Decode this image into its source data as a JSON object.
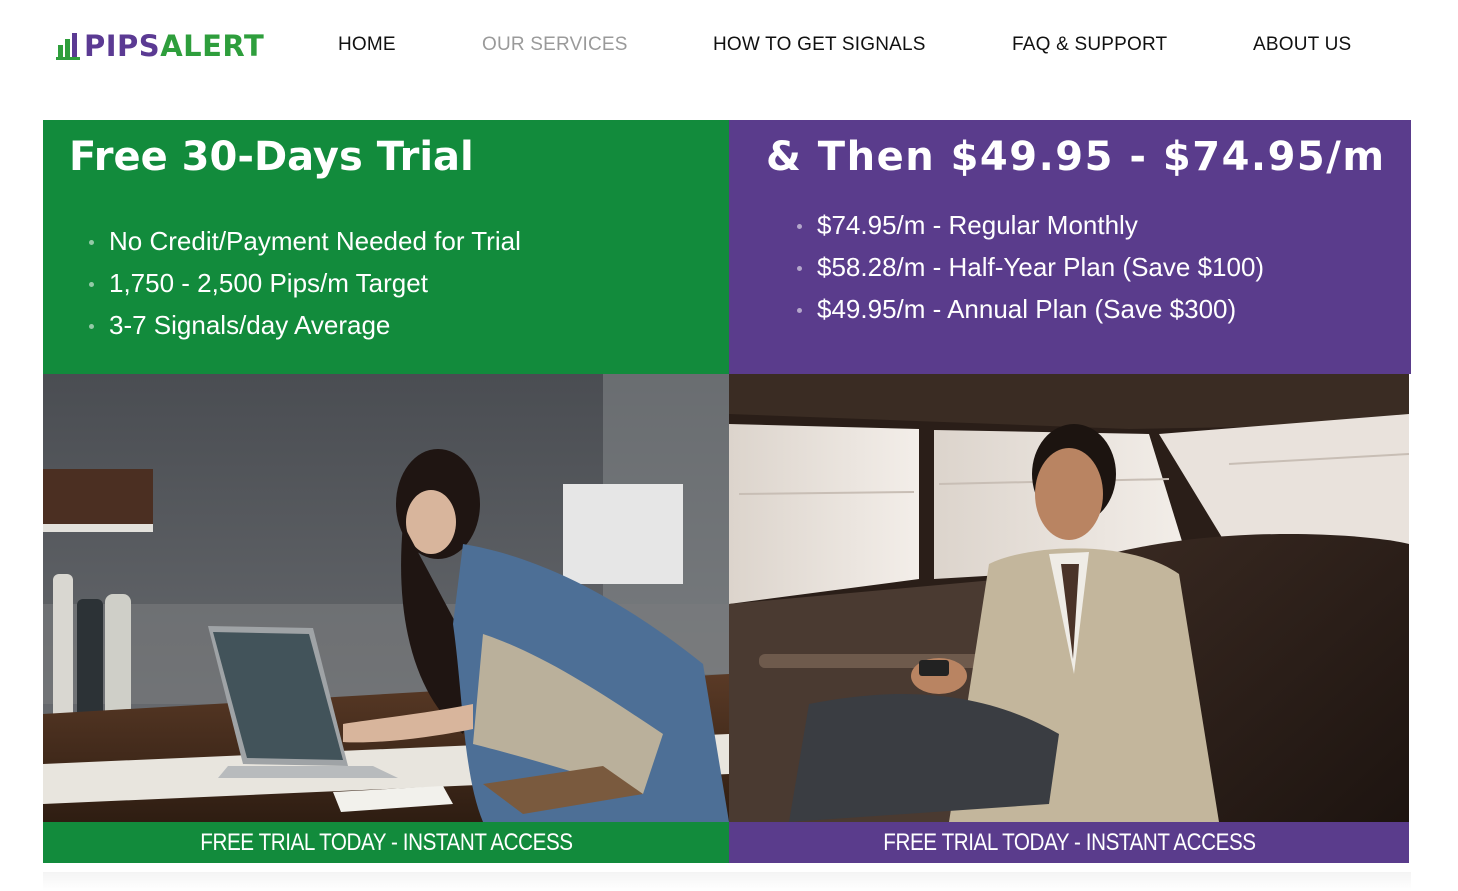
{
  "colors": {
    "brand_purple": "#5a3c8c",
    "brand_green": "#128b3c",
    "nav_active": "#9a9a9a"
  },
  "logo": {
    "text_part1": "PIPS",
    "text_part2": "ALERT",
    "icon": "chart-bars-logo-icon"
  },
  "nav": {
    "items": [
      {
        "label": "HOME",
        "active": false
      },
      {
        "label": "OUR SERVICES",
        "active": true
      },
      {
        "label": "HOW TO GET SIGNALS",
        "active": false
      },
      {
        "label": "FAQ & SUPPORT",
        "active": false
      },
      {
        "label": "ABOUT US",
        "active": false
      }
    ]
  },
  "trial": {
    "title": "Free 30-Days Trial",
    "bullets": [
      "No Credit/Payment Needed for Trial",
      "1,750 - 2,500 Pips/m Target",
      "3-7 Signals/day Average"
    ],
    "cta": "FREE TRIAL TODAY - INSTANT ACCESS"
  },
  "pricing": {
    "title": "& Then $49.95 - $74.95/m",
    "bullets": [
      "$74.95/m - Regular Monthly",
      "$58.28/m - Half-Year Plan (Save $100)",
      "$49.95/m - Annual Plan (Save $300)"
    ],
    "cta": "FREE TRIAL TODAY - INSTANT ACCESS"
  }
}
